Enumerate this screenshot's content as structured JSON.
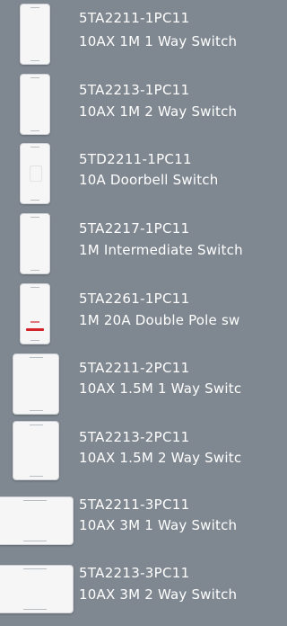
{
  "products": [
    {
      "code": "5TA2211-1PC11",
      "desc": "10AX 1M 1 Way Switch",
      "icon": "1m-switch-icon"
    },
    {
      "code": "5TA2213-1PC11",
      "desc": "10AX 1M  2 Way Switch",
      "icon": "1m-switch-icon"
    },
    {
      "code": "5TD2211-1PC11",
      "desc": "10A Doorbell Switch",
      "icon": "doorbell-switch-icon"
    },
    {
      "code": "5TA2217-1PC11",
      "desc": "1M Intermediate Switch",
      "icon": "1m-switch-icon"
    },
    {
      "code": "5TA2261-1PC11",
      "desc": "1M 20A Double Pole sw",
      "icon": "double-pole-switch-icon"
    },
    {
      "code": "5TA2211-2PC11",
      "desc": "10AX 1.5M 1 Way Switc",
      "icon": "1-5m-switch-icon"
    },
    {
      "code": "5TA2213-2PC11",
      "desc": "10AX 1.5M 2 Way Switc",
      "icon": "1-5m-switch-icon"
    },
    {
      "code": "5TA2211-3PC11",
      "desc": "10AX 3M 1 Way Switch",
      "icon": "3m-switch-icon"
    },
    {
      "code": "5TA2213-3PC11",
      "desc": "10AX 3M 2 Way Switch",
      "icon": "3m-switch-icon"
    }
  ],
  "colors": {
    "background": "#7f8790",
    "text": "#ffffff",
    "switch_body": "#f6f6f6",
    "indicator_red": "#d2232a"
  }
}
